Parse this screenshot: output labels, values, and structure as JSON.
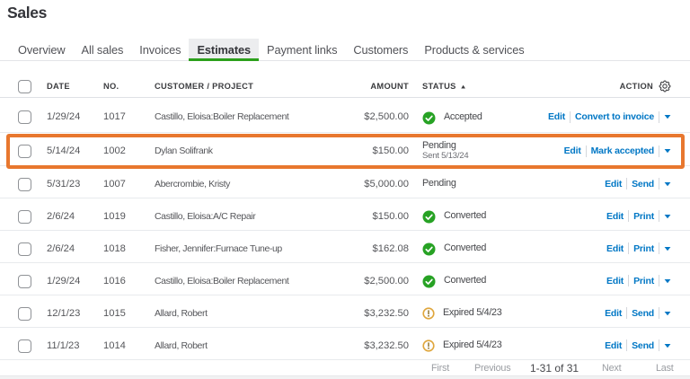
{
  "page": {
    "title": "Sales"
  },
  "tabs": [
    {
      "label": "Overview",
      "active": false
    },
    {
      "label": "All sales",
      "active": false
    },
    {
      "label": "Invoices",
      "active": false
    },
    {
      "label": "Estimates",
      "active": true
    },
    {
      "label": "Payment links",
      "active": false
    },
    {
      "label": "Customers",
      "active": false
    },
    {
      "label": "Products & services",
      "active": false
    }
  ],
  "table": {
    "headers": {
      "date": "DATE",
      "no": "NO.",
      "customer": "CUSTOMER / PROJECT",
      "amount": "AMOUNT",
      "status": "STATUS",
      "action": "ACTION"
    },
    "sort": {
      "column": "status",
      "direction": "asc"
    },
    "rows": [
      {
        "date": "1/29/24",
        "no": "1017",
        "customer": "Castillo, Eloisa:Boiler Replacement",
        "amount": "$2,500.00",
        "status": "Accepted",
        "status_sub": "",
        "status_icon": "check-circle",
        "actions": [
          "Edit",
          "Convert to invoice"
        ],
        "highlighted": false
      },
      {
        "date": "5/14/24",
        "no": "1002",
        "customer": "Dylan Solifrank",
        "amount": "$150.00",
        "status": "Pending",
        "status_sub": "Sent 5/13/24",
        "status_icon": "none",
        "actions": [
          "Edit",
          "Mark accepted"
        ],
        "highlighted": true
      },
      {
        "date": "5/31/23",
        "no": "1007",
        "customer": "Abercrombie, Kristy",
        "amount": "$5,000.00",
        "status": "Pending",
        "status_sub": "",
        "status_icon": "none",
        "actions": [
          "Edit",
          "Send"
        ],
        "highlighted": false
      },
      {
        "date": "2/6/24",
        "no": "1019",
        "customer": "Castillo, Eloisa:A/C Repair",
        "amount": "$150.00",
        "status": "Converted",
        "status_sub": "",
        "status_icon": "check-circle",
        "actions": [
          "Edit",
          "Print"
        ],
        "highlighted": false
      },
      {
        "date": "2/6/24",
        "no": "1018",
        "customer": "Fisher, Jennifer:Furnace Tune-up",
        "amount": "$162.08",
        "status": "Converted",
        "status_sub": "",
        "status_icon": "check-circle",
        "actions": [
          "Edit",
          "Print"
        ],
        "highlighted": false
      },
      {
        "date": "1/29/24",
        "no": "1016",
        "customer": "Castillo, Eloisa:Boiler Replacement",
        "amount": "$2,500.00",
        "status": "Converted",
        "status_sub": "",
        "status_icon": "check-circle",
        "actions": [
          "Edit",
          "Print"
        ],
        "highlighted": false
      },
      {
        "date": "12/1/23",
        "no": "1015",
        "customer": "Allard, Robert",
        "amount": "$3,232.50",
        "status": "Expired 5/4/23",
        "status_sub": "",
        "status_icon": "warning-circle",
        "actions": [
          "Edit",
          "Send"
        ],
        "highlighted": false
      },
      {
        "date": "11/1/23",
        "no": "1014",
        "customer": "Allard, Robert",
        "amount": "$3,232.50",
        "status": "Expired 5/4/23",
        "status_sub": "",
        "status_icon": "warning-circle",
        "actions": [
          "Edit",
          "Send"
        ],
        "highlighted": false
      }
    ]
  },
  "pagination": {
    "first": "First",
    "previous": "Previous",
    "range": "1-31 of 31",
    "next": "Next",
    "last": "Last"
  },
  "icons": {
    "header_settings": "gear-icon",
    "status_sort": "sort-ascending-icon",
    "row_menu": "caret-down-icon",
    "status_ok": "check-circle-icon",
    "status_warning": "warning-circle-icon"
  },
  "select_all_checked": false,
  "colors": {
    "accent_green": "#2CA01C",
    "link_blue": "#0077C5",
    "warning_amber": "#E2A33B",
    "highlight_orange": "#E8772E",
    "text_dark": "#393A3D",
    "text_gray": "#6B6C72",
    "border_gray": "#E3E5E8"
  }
}
